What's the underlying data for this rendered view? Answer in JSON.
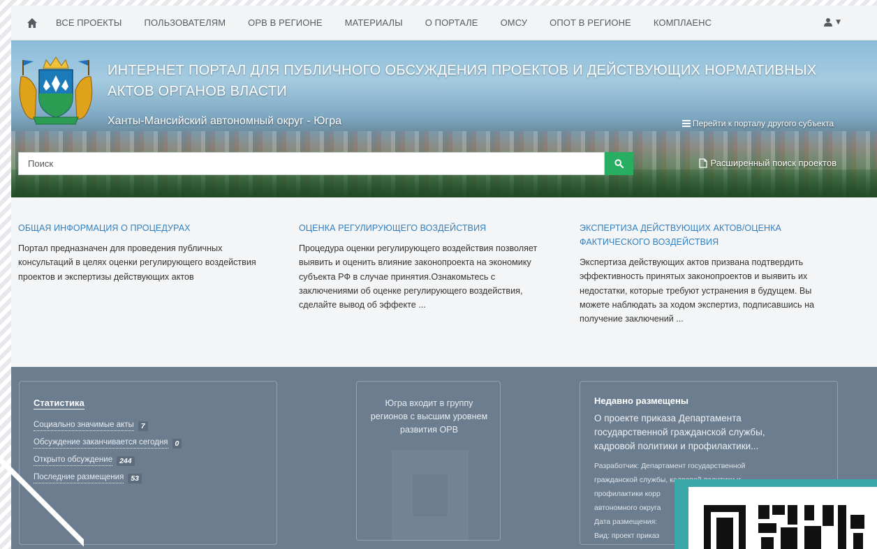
{
  "nav": {
    "items": [
      "ВСЕ ПРОЕКТЫ",
      "ПОЛЬЗОВАТЕЛЯМ",
      "ОРВ В РЕГИОНЕ",
      "МАТЕРИАЛЫ",
      "О ПОРТАЛЕ",
      "ОМСУ",
      "ОПОТ В РЕГИОНЕ",
      "КОМПЛАЕНС"
    ]
  },
  "hero": {
    "title": "ИНТЕРНЕТ ПОРТАЛ ДЛЯ ПУБЛИЧНОГО ОБСУЖДЕНИЯ ПРОЕКТОВ И ДЕЙСТВУЮЩИХ НОРМАТИВНЫХ АКТОВ ОРГАНОВ ВЛАСТИ",
    "region": "Ханты-Мансийский автономный округ - Югра",
    "other_portal": "Перейти к порталу другого субъекта",
    "search_placeholder": "Поиск",
    "advanced_search": "Расширенный поиск проектов"
  },
  "info": {
    "columns": [
      {
        "title": "ОБЩАЯ ИНФОРМАЦИЯ О ПРОЦЕДУРАХ",
        "text": "Портал предназначен для проведения публичных консультаций в целях оценки регулирующего воздействия проектов и экспертизы действующих актов"
      },
      {
        "title": "ОЦЕНКА РЕГУЛИРУЮЩЕГО ВОЗДЕЙСТВИЯ",
        "text": "Процедура оценки регулирующего воздействия позволяет выявить и оценить влияние законопроекта на экономику субъекта РФ в случае принятия.Ознакомьтесь с заключениями об оценке регулирующего воздействия, сделайте вывод об эффекте ..."
      },
      {
        "title": "ЭКСПЕРТИЗА ДЕЙСТВУЮЩИХ АКТОВ/ОЦЕНКА ФАКТИЧЕСКОГО ВОЗДЕЙСТВИЯ",
        "text": "Экспертиза действующих актов призвана подтвердить эффективность принятых законопроектов и выявить их недостатки, которые требуют устранения в будущем. Вы можете наблюдать за ходом экспертиз, подписавшись на получение заключений ..."
      }
    ]
  },
  "stats": {
    "title": "Статистика",
    "rows": [
      {
        "label": "Социально значимые акты",
        "count": "7"
      },
      {
        "label": "Обсуждение заканчивается сегодня",
        "count": "0"
      },
      {
        "label": "Открыто обсуждение",
        "count": "244"
      },
      {
        "label": "Последние размещения",
        "count": "53"
      }
    ]
  },
  "group": {
    "text": "Югра входит в группу регионов с высшим уровнем развития ОРВ"
  },
  "recent": {
    "title": "Недавно размещены",
    "link": "О проекте приказа Департамента государственной гражданской службы, кадровой политики и профилактики...",
    "developer_line1": "Разработчик: Департамент государственной",
    "developer_line2": "гражданской службы, кадровой политики и",
    "developer_line3": "профилактики корр",
    "developer_line4": "автономного округа",
    "date_label": "Дата размещения:",
    "kind_label": "Вид: проект приказ"
  }
}
